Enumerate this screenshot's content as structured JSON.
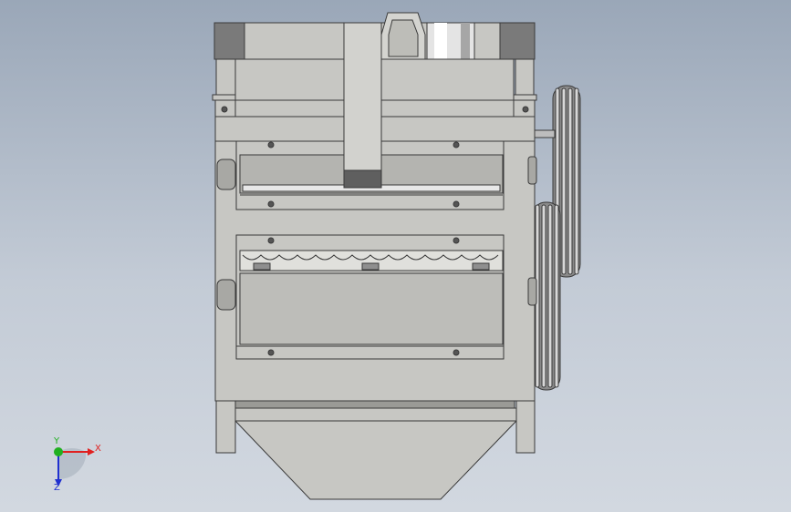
{
  "window": {
    "title": ""
  },
  "viewport": {
    "background_top": "#9aa7b8",
    "background_bottom": "#d2d8e0",
    "part_fill": "#c7c7c3",
    "part_edge": "#3a3a3a",
    "dark_block": "#6b6b6b"
  },
  "triad": {
    "x_label": "X",
    "y_label": "Y",
    "z_label": "Z",
    "x_color": "#e02020",
    "y_color": "#20b020",
    "z_color": "#2030d0"
  },
  "icons": [
    "coordinate-triad-icon",
    "origin-sphere-icon"
  ]
}
